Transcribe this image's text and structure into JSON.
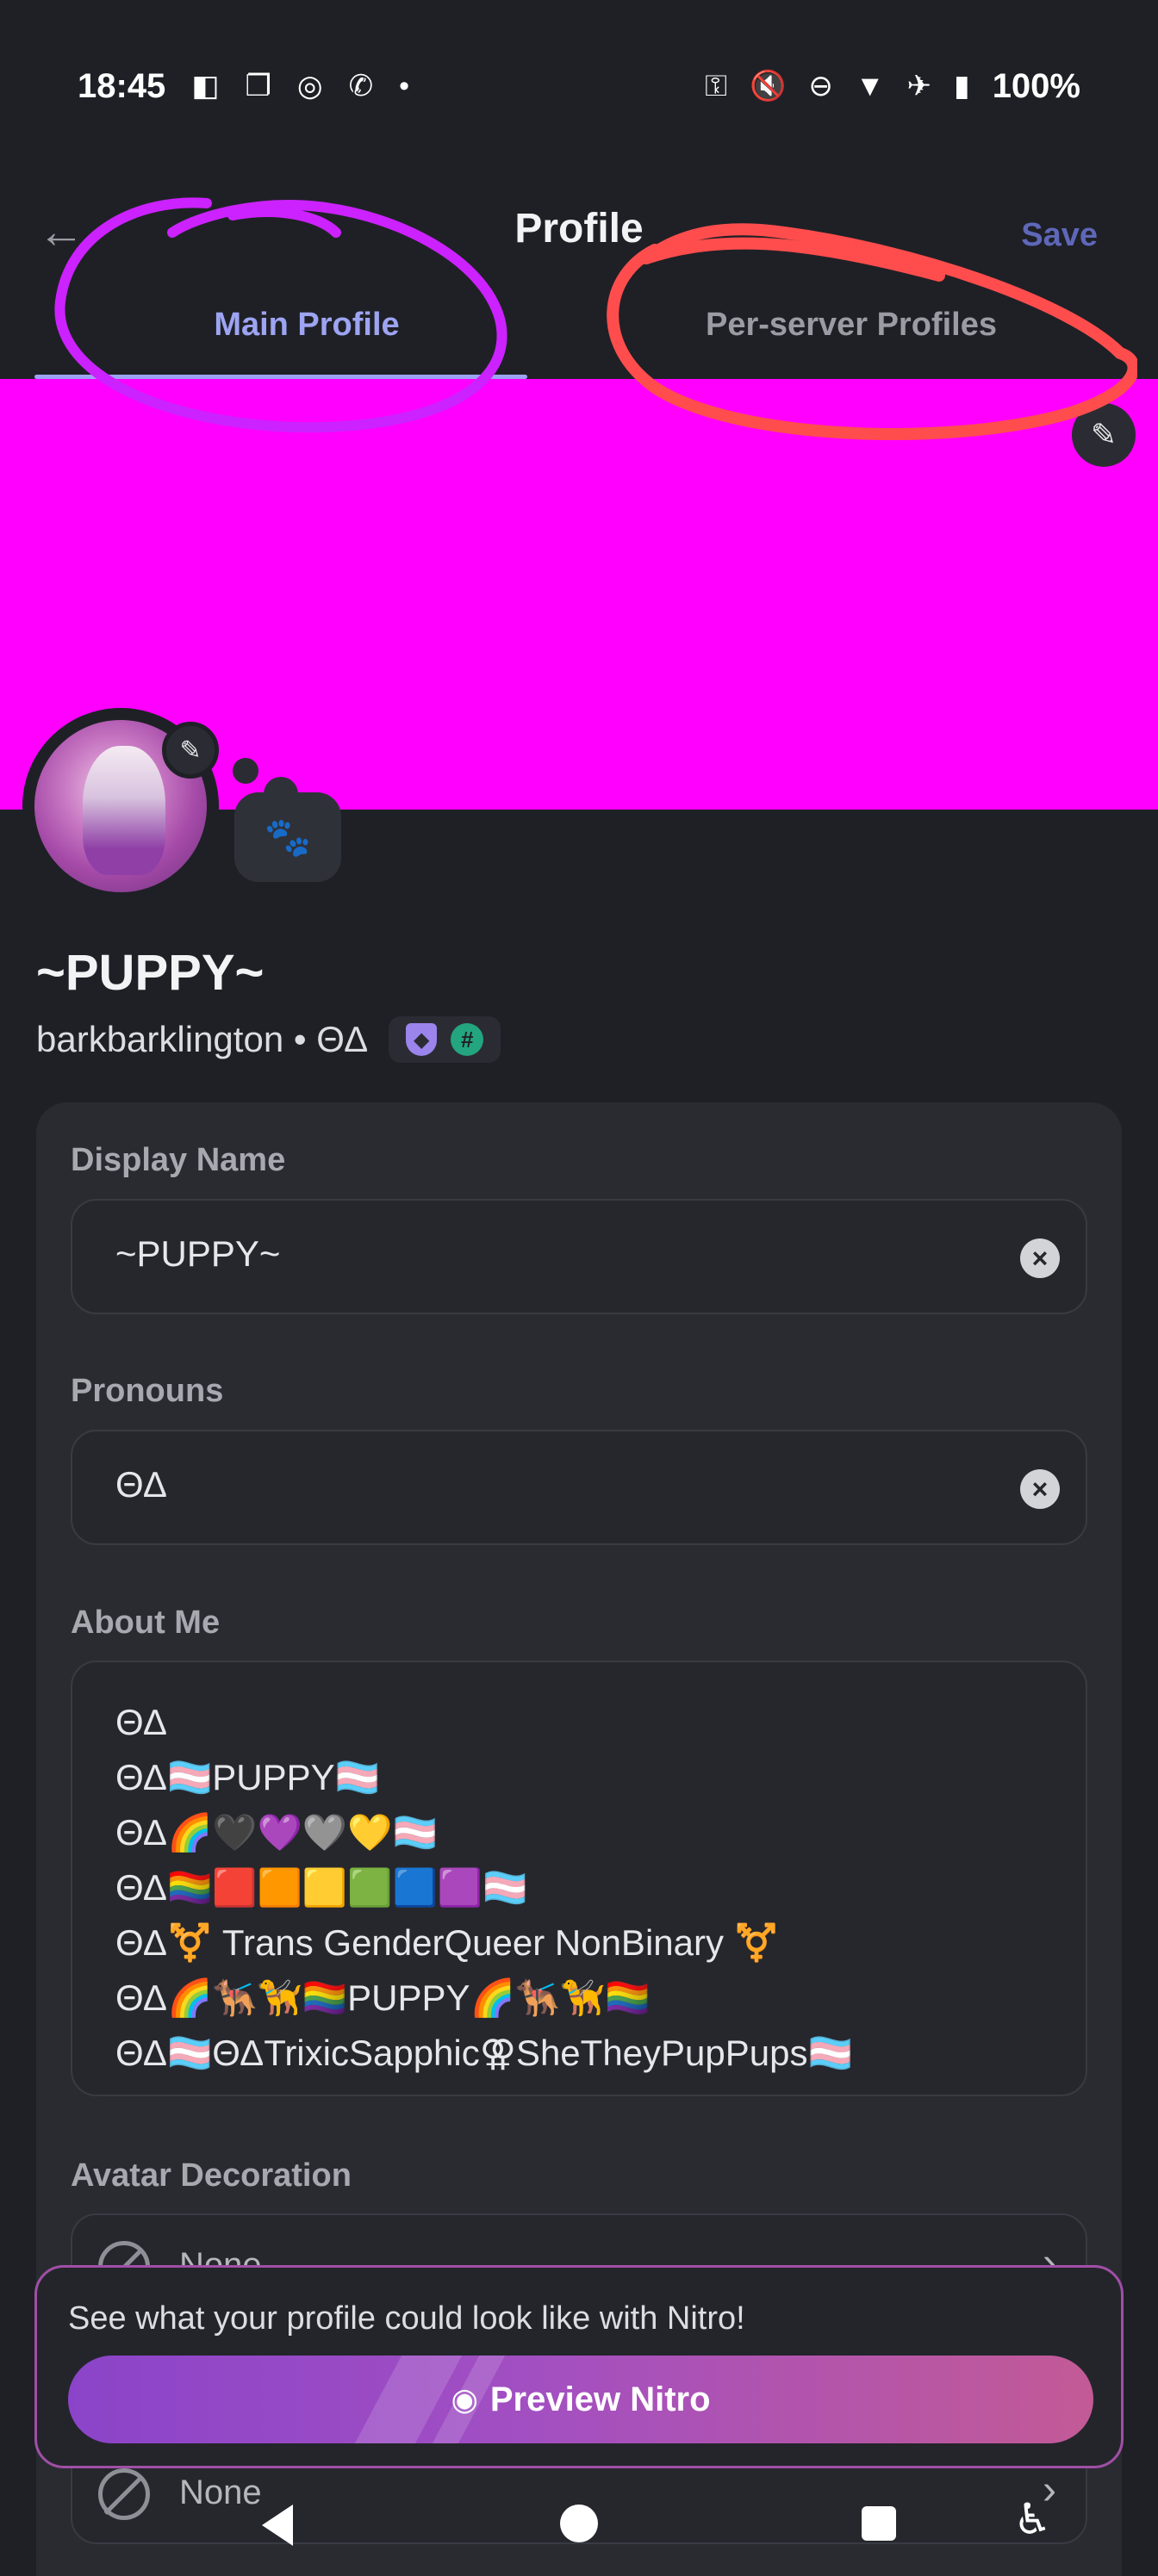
{
  "status_bar": {
    "time": "18:45",
    "battery": "100%",
    "left_icons": [
      "switch-icon",
      "screen-icon",
      "chrome-icon",
      "call-icon",
      "dot-icon"
    ],
    "right_icons": [
      "key-icon",
      "mute-icon",
      "dnd-icon",
      "wifi-icon",
      "airplane-icon",
      "battery-icon"
    ]
  },
  "header": {
    "title": "Profile",
    "save_label": "Save",
    "back_icon": "arrow-left-icon"
  },
  "tabs": [
    {
      "label": "Main Profile",
      "active": true
    },
    {
      "label": "Per-server Profiles",
      "active": false
    }
  ],
  "banner": {
    "color": "#ff00ff"
  },
  "profile": {
    "display_name": "~PUPPY~",
    "username_line": "barkbarklington • ΘΔ",
    "status_emoji": "🐾"
  },
  "form": {
    "display_name_label": "Display Name",
    "display_name_value": "~PUPPY~",
    "pronouns_label": "Pronouns",
    "pronouns_value": "ΘΔ",
    "about_label": "About Me",
    "about_lines": [
      "ΘΔ",
      "ΘΔ🏳️‍⚧️PUPPY🏳️‍⚧️",
      "ΘΔ🌈🖤💜🩶💛🏳️‍⚧️",
      "ΘΔ🏳️‍🌈🟥🟧🟨🟩🟦🟪🏳️‍⚧️",
      "ΘΔ⚧️ Trans GenderQueer NonBinary ⚧️",
      "ΘΔ🌈🐕‍🦺🦮🏳️‍🌈PUPPY🌈🐕‍🦺🦮🏳️‍🌈",
      "ΘΔ🏳️‍⚧️ΘΔTrixicSapphic⚢SheTheyPupPups🏳️‍⚧️"
    ],
    "avatar_decoration_label": "Avatar Decoration",
    "avatar_decoration_value": "None",
    "profile_effect_value": "None"
  },
  "nitro": {
    "text": "See what your profile could look like with Nitro!",
    "button_label": "Preview Nitro"
  },
  "colors": {
    "background": "#1f2026",
    "accent": "#9da4f2",
    "annotation_purple": "#cc22ff",
    "annotation_red": "#ff4d4d"
  }
}
